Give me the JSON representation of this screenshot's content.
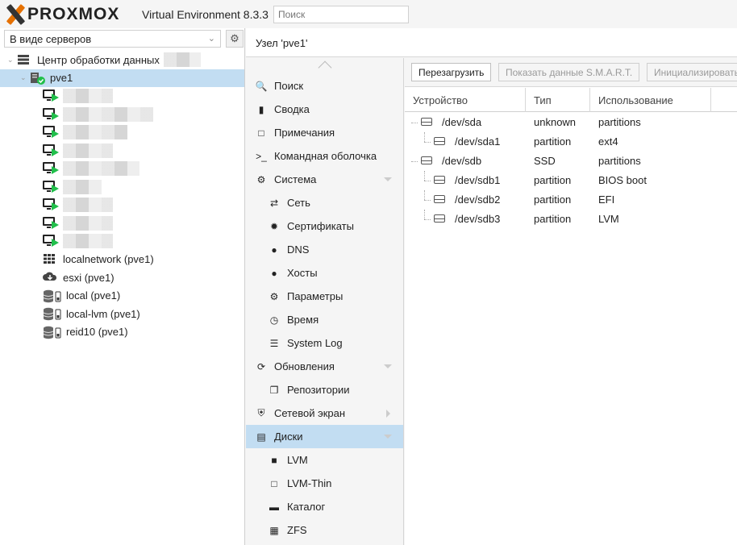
{
  "header": {
    "brand": "PROXMOX",
    "product": "Virtual Environment 8.3.3",
    "search_placeholder": "Поиск"
  },
  "left": {
    "view_select": "В виде серверов",
    "tree": {
      "datacenter": "Центр обработки данных",
      "node": "pve1",
      "vm_count": 9,
      "storages": [
        {
          "label": "localnetwork (pve1)",
          "icon": "grid-icon"
        },
        {
          "label": "esxi (pve1)",
          "icon": "cloud-download-icon"
        },
        {
          "label": "local (pve1)",
          "icon": "storage-icon"
        },
        {
          "label": "local-lvm (pve1)",
          "icon": "storage-icon"
        },
        {
          "label": "reid10 (pve1)",
          "icon": "storage-icon"
        }
      ]
    }
  },
  "breadcrumb": "Узел 'pve1'",
  "nav": [
    {
      "label": "Поиск",
      "icon": "search-icon",
      "level": 0
    },
    {
      "label": "Сводка",
      "icon": "book-icon",
      "level": 0
    },
    {
      "label": "Примечания",
      "icon": "note-icon",
      "level": 0
    },
    {
      "label": "Командная оболочка",
      "icon": "terminal-icon",
      "level": 0
    },
    {
      "label": "Система",
      "icon": "cogs-icon",
      "level": 0,
      "expandable": true
    },
    {
      "label": "Сеть",
      "icon": "exchange-icon",
      "level": 1
    },
    {
      "label": "Сертификаты",
      "icon": "certificate-icon",
      "level": 1
    },
    {
      "label": "DNS",
      "icon": "globe-icon",
      "level": 1
    },
    {
      "label": "Хосты",
      "icon": "globe-icon",
      "level": 1
    },
    {
      "label": "Параметры",
      "icon": "gear-icon",
      "level": 1
    },
    {
      "label": "Время",
      "icon": "clock-icon",
      "level": 1
    },
    {
      "label": "System Log",
      "icon": "list-icon",
      "level": 1
    },
    {
      "label": "Обновления",
      "icon": "refresh-icon",
      "level": 0,
      "expandable": true
    },
    {
      "label": "Репозитории",
      "icon": "files-icon",
      "level": 1
    },
    {
      "label": "Сетевой экран",
      "icon": "shield-icon",
      "level": 0,
      "collapsed": true
    },
    {
      "label": "Диски",
      "icon": "hdd-icon",
      "level": 0,
      "expandable": true,
      "selected": true
    },
    {
      "label": "LVM",
      "icon": "square-icon",
      "level": 1
    },
    {
      "label": "LVM-Thin",
      "icon": "square-outline-icon",
      "level": 1
    },
    {
      "label": "Каталог",
      "icon": "folder-icon",
      "level": 1
    },
    {
      "label": "ZFS",
      "icon": "th-large-icon",
      "level": 1
    }
  ],
  "toolbar": {
    "reload": "Перезагрузить",
    "smart": "Показать данные S.M.A.R.T.",
    "init": "Инициализировать"
  },
  "table": {
    "columns": [
      "Устройство",
      "Тип",
      "Использование"
    ],
    "rows": [
      {
        "device": "/dev/sda",
        "type": "unknown",
        "usage": "partitions",
        "level": 0
      },
      {
        "device": "/dev/sda1",
        "type": "partition",
        "usage": "ext4",
        "level": 1
      },
      {
        "device": "/dev/sdb",
        "type": "SSD",
        "usage": "partitions",
        "level": 0
      },
      {
        "device": "/dev/sdb1",
        "type": "partition",
        "usage": "BIOS boot",
        "level": 1
      },
      {
        "device": "/dev/sdb2",
        "type": "partition",
        "usage": "EFI",
        "level": 1
      },
      {
        "device": "/dev/sdb3",
        "type": "partition",
        "usage": "LVM",
        "level": 1
      }
    ]
  }
}
